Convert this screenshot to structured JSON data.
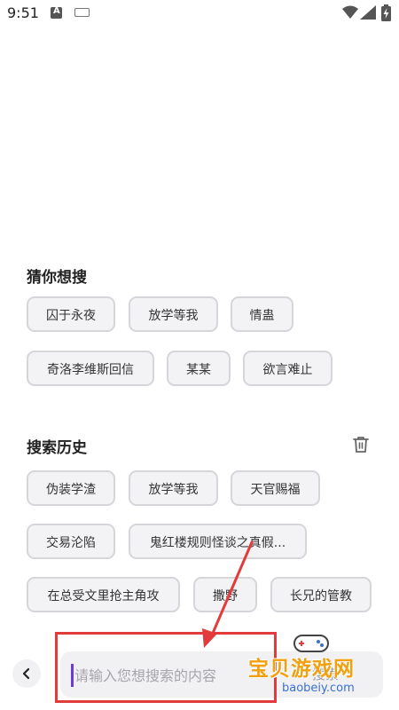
{
  "status_bar": {
    "time": "9:51",
    "left_icons": [
      "a-notification-icon",
      "keyboard-icon"
    ],
    "right_icons": [
      "wifi-icon",
      "signal-icon",
      "battery-charging-icon"
    ]
  },
  "suggestions": {
    "title": "猜你想搜",
    "chips": [
      "囚于永夜",
      "放学等我",
      "情蛊",
      "奇洛李维斯回信",
      "某某",
      "欲言难止"
    ]
  },
  "history": {
    "title": "搜索历史",
    "delete_icon": "trash-icon",
    "chips": [
      "伪装学渣",
      "放学等我",
      "天官赐福",
      "交易沦陷",
      "鬼红楼规则怪谈之真假...",
      "在总受文里抢主角攻",
      "撒野",
      "长兄的管教"
    ]
  },
  "search_bar": {
    "back_icon": "chevron-left-icon",
    "placeholder": "请输入您想搜索的内容",
    "value": "",
    "submit_label": "搜索"
  },
  "annotation": {
    "color": "#e23b3b"
  },
  "watermark": {
    "text": "宝贝游戏网",
    "url": "baobeiy.com"
  },
  "colors": {
    "chip_bg": "#f3f3f5",
    "chip_border": "#d6d6da",
    "caret": "#6a3fd0",
    "watermark": "#f0a010"
  }
}
